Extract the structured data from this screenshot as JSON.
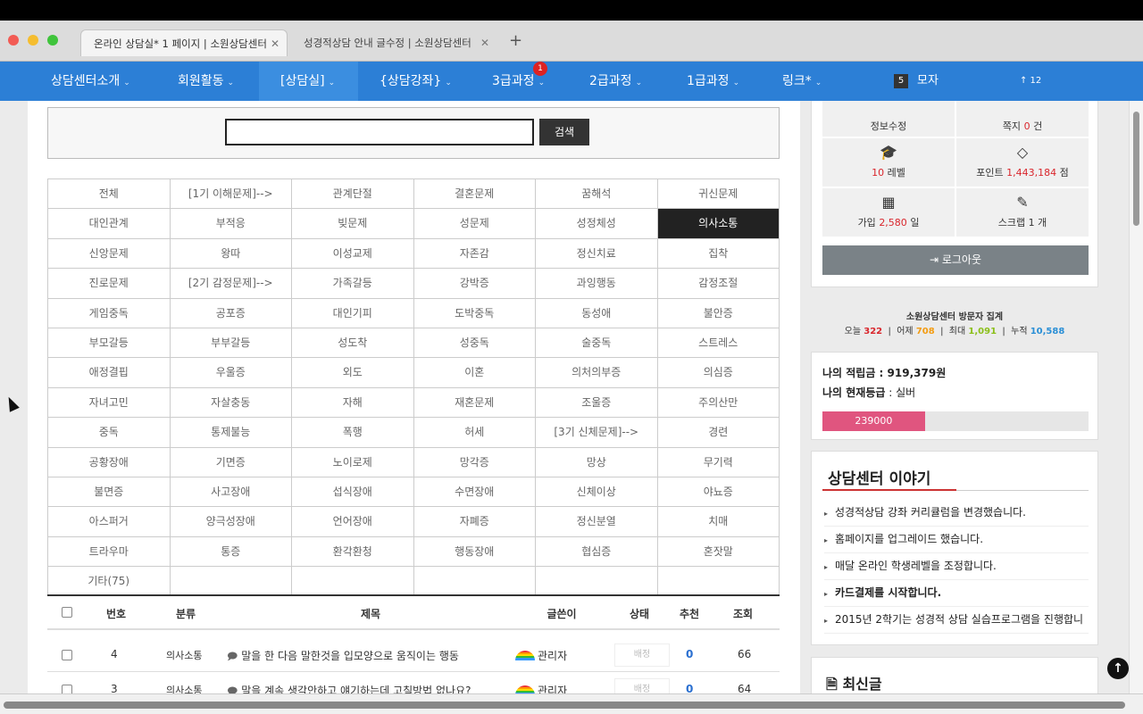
{
  "browser": {
    "tabs": [
      {
        "label": "온라인 상담실* 1 페이지 | 소원상담센터"
      },
      {
        "label": "성경적상담 안내 글수정 | 소원상담센터"
      }
    ],
    "close_glyph": "✕",
    "new_tab_glyph": "+"
  },
  "nav": {
    "items": [
      {
        "label": "상담센터소개"
      },
      {
        "label": "회원활동"
      },
      {
        "label": "[상담실]"
      },
      {
        "label": "{상담강좌}"
      },
      {
        "label": "3급과정",
        "badge": "1"
      },
      {
        "label": "2급과정"
      },
      {
        "label": "1급과정"
      },
      {
        "label": "링크*"
      }
    ],
    "caret": "⌄",
    "box_number": "5",
    "box_label": "모자",
    "arrow_count": "↑ 12"
  },
  "search": {
    "value": "",
    "button_label": "검색"
  },
  "categories": [
    "전체",
    "[1기 이해문제]-->",
    "관계단절",
    "결혼문제",
    "꿈해석",
    "귀신문제",
    "대인관계",
    "부적응",
    "빚문제",
    "성문제",
    "성정체성",
    "의사소통",
    "신앙문제",
    "왕따",
    "이성교제",
    "자존감",
    "정신치료",
    "집착",
    "진로문제",
    "[2기 감정문제]-->",
    "가족갈등",
    "강박증",
    "과잉행동",
    "감정조절",
    "게임중독",
    "공포증",
    "대인기피",
    "도박중독",
    "동성애",
    "불안증",
    "부모갈등",
    "부부갈등",
    "성도착",
    "성중독",
    "술중독",
    "스트레스",
    "애정결핍",
    "우울증",
    "외도",
    "이혼",
    "의처의부증",
    "의심증",
    "자녀고민",
    "자살충동",
    "자해",
    "재혼문제",
    "조울증",
    "주의산만",
    "중독",
    "통제불능",
    "폭행",
    "허세",
    "[3기 신체문제]-->",
    "경련",
    "공황장애",
    "기면증",
    "노이로제",
    "망각증",
    "망상",
    "무기력",
    "불면증",
    "사고장애",
    "섭식장애",
    "수면장애",
    "신체이상",
    "야뇨증",
    "아스퍼거",
    "양극성장애",
    "언어장애",
    "자폐증",
    "정신분열",
    "치매",
    "트라우마",
    "통증",
    "환각환청",
    "행동장애",
    "협심증",
    "혼잣말",
    "기타(75)",
    "",
    "",
    "",
    "",
    ""
  ],
  "selected_category": "의사소통",
  "table": {
    "headers": {
      "no": "번호",
      "category": "분류",
      "title": "제목",
      "author": "글쓴이",
      "status": "상태",
      "recommend": "추천",
      "views": "조회"
    },
    "rows": [
      {
        "no": "4",
        "category": "의사소통",
        "title": "말을 한 다음 말한것을 입모양으로 움직이는 행동",
        "author": "관리자",
        "status": "배정",
        "recommend": "0",
        "views": "66"
      },
      {
        "no": "3",
        "category": "의사소통",
        "title": "말을 계속 생각안하고 얘기하는데 고칠방법 없나요?",
        "author": "관리자",
        "status": "배정",
        "recommend": "0",
        "views": "64"
      }
    ]
  },
  "user_panel": {
    "edit_info": "정보수정",
    "messages_prefix": "쪽지",
    "messages_count": "0",
    "messages_suffix": "건",
    "level_value": "10",
    "level_label": "레벨",
    "points_prefix": "포인트",
    "points_value": "1,443,184",
    "points_suffix": "점",
    "joined_prefix": "가입",
    "joined_value": "2,580",
    "joined_suffix": "일",
    "scrap_label": "스크랩 1 개",
    "logout_label": "로그아웃"
  },
  "visitors": {
    "title": "소원상담센터 방문자 집계",
    "today_label": "오늘",
    "today": "322",
    "yesterday_label": "어제",
    "yesterday": "708",
    "max_label": "최대",
    "max": "1,091",
    "total_label": "누적",
    "total": "10,588",
    "sep": "|"
  },
  "reserve": {
    "points_label": "나의 적립금 : 919,379원",
    "grade_label": "나의 현재등급",
    "grade_value": " : 실버",
    "progress_text": "239000",
    "progress_fraction": 0.385
  },
  "stories": {
    "title": "상담센터 이야기",
    "items": [
      "성경적상담 강좌 커리큘럼을 변경했습니다.",
      "홈페이지를 업그레이드 했습니다.",
      "매달 온라인 학생레벨을 조정합니다.",
      "카드결제를 시작합니다.",
      "2015년 2학기는 성경적 상담 실습프로그램을 진행합니"
    ]
  },
  "latest": {
    "title": "최신글"
  },
  "colors": {
    "nav_bg": "#2c7fd6",
    "accent_red": "#d9262c",
    "progress": "#e0557f"
  }
}
